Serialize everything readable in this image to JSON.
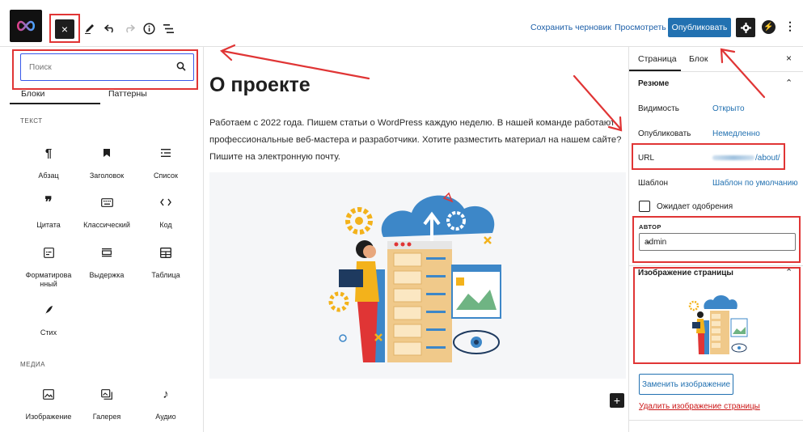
{
  "toolbar": {
    "close_label": "×",
    "save_draft": "Сохранить черновик",
    "preview": "Просмотреть",
    "publish": "Опубликовать"
  },
  "inserter": {
    "search_placeholder": "Поиск",
    "tabs": [
      "Блоки",
      "Паттерны"
    ],
    "sections": {
      "text": "ТЕКСТ",
      "media": "МЕДИА"
    },
    "blocks": [
      {
        "label": "Абзац",
        "icon": "paragraph-icon"
      },
      {
        "label": "Заголовок",
        "icon": "heading-icon"
      },
      {
        "label": "Список",
        "icon": "list-icon"
      },
      {
        "label": "Цитата",
        "icon": "quote-icon"
      },
      {
        "label": "Классический",
        "icon": "keyboard-icon"
      },
      {
        "label": "Код",
        "icon": "code-icon"
      },
      {
        "label": "Форматирова нный",
        "icon": "preformatted-icon"
      },
      {
        "label": "Выдержка",
        "icon": "pullquote-icon"
      },
      {
        "label": "Таблица",
        "icon": "table-icon"
      },
      {
        "label": "Стих",
        "icon": "verse-icon"
      }
    ],
    "media_blocks": [
      {
        "label": "Изображение",
        "icon": "image-icon"
      },
      {
        "label": "Галерея",
        "icon": "gallery-icon"
      },
      {
        "label": "Аудио",
        "icon": "audio-icon"
      }
    ]
  },
  "content": {
    "title": "О проекте",
    "paragraph": "Работаем с 2022 года. Пишем статьи о WordPress каждую неделю. В нашей команде работают профессиональные веб-мастера и разработчики. Хотите разместить материал на нашем сайте? Пишите на электронную почту."
  },
  "sidebar": {
    "tabs": [
      "Страница",
      "Блок"
    ],
    "close": "×",
    "summary_title": "Резюме",
    "rows": [
      {
        "label": "Видимость",
        "value": "Открыто"
      },
      {
        "label": "Опубликовать",
        "value": "Немедленно"
      },
      {
        "label": "URL",
        "value": "/about/"
      },
      {
        "label": "Шаблон",
        "value": "Шаблон по умолчанию"
      }
    ],
    "pending_review": "Ожидает одобрения",
    "author_label": "АВТОР",
    "author_value": "admin",
    "featured_image_title": "Изображение страницы",
    "replace_image": "Заменить изображение",
    "remove_image": "Удалить изображение страницы"
  },
  "colors": {
    "accent": "#2271b1",
    "annotation": "#e03535",
    "danger": "#cc1818"
  }
}
